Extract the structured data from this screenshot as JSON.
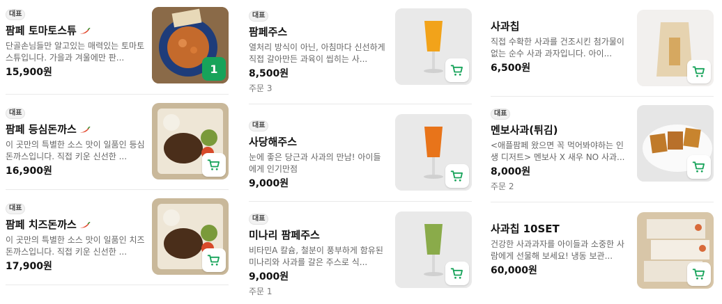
{
  "colors": {
    "accent": "#17a35a",
    "badge_bg": "#f2f2f2",
    "divider": "#e9e9e9"
  },
  "columns": [
    {
      "items": [
        {
          "badge": "대표",
          "name": "팜페 토마토스튜",
          "spicy": true,
          "desc": "단골손님들만 알고있는 매력있는 토마토스튜입니다. 가을과 겨울에만 판...",
          "price": "15,900원",
          "orders": "",
          "cart_qty": "1",
          "image": "tomato-stew"
        },
        {
          "badge": "대표",
          "name": "팜페 등심돈까스",
          "spicy": true,
          "desc": "이 곳만의 특별한 소스 맛이 일품인 등심돈까스입니다. 직접 키운 신선한 ...",
          "price": "16,900원",
          "orders": "",
          "cart_qty": "",
          "image": "pork-cutlet"
        },
        {
          "badge": "대표",
          "name": "팜페 치즈돈까스",
          "spicy": true,
          "desc": "이 곳만의 특별한 소스 맛이 일품인 치즈돈까스입니다. 직접 키운 신선한 ...",
          "price": "17,900원",
          "orders": "",
          "cart_qty": "",
          "image": "cheese-cutlet"
        }
      ]
    },
    {
      "items": [
        {
          "badge": "대표",
          "name": "팜페주스",
          "spicy": false,
          "desc": "열처리 방식이 아닌, 아침마다 신선하게 직접 갈아만든 과육이 씹히는 사...",
          "price": "8,500원",
          "orders": "주문 3",
          "cart_qty": "",
          "image": "orange-juice"
        },
        {
          "badge": "대표",
          "name": "사당해주스",
          "spicy": false,
          "desc": "눈에 좋은 당근과 사과의 만남! 아이들에게 인기만점",
          "price": "9,000원",
          "orders": "",
          "cart_qty": "",
          "image": "carrot-juice"
        },
        {
          "badge": "대표",
          "name": "미나리 팜페주스",
          "spicy": false,
          "desc": "비타민A 칼슘, 철분이 풍부하게 함유된 미나리와 사과를 갈은 주스로 식...",
          "price": "9,000원",
          "orders": "주문 1",
          "cart_qty": "",
          "image": "green-juice"
        }
      ]
    },
    {
      "items": [
        {
          "badge": "",
          "name": "사과칩",
          "spicy": false,
          "desc": "직접 수확한 사과를 건조시킨 첨가물이 없는 순수 사과 과자입니다. 아이...",
          "price": "6,500원",
          "orders": "",
          "cart_qty": "",
          "image": "apple-chips"
        },
        {
          "badge": "대표",
          "name": "멘보사과(튀김)",
          "spicy": false,
          "desc": "<애플팜페 왔으면 꼭 먹어봐야하는 인생 디저트> 멘보사 X 새우 NO 사과...",
          "price": "8,000원",
          "orders": "주문 2",
          "cart_qty": "",
          "image": "menbosa"
        },
        {
          "badge": "",
          "name": "사과칩 10SET",
          "spicy": false,
          "desc": "건강한 사과과자를 아이들과 소중한 사람에게 선물해 보세요! 냉동 보관...",
          "price": "60,000원",
          "orders": "",
          "cart_qty": "",
          "image": "apple-chips-set"
        }
      ]
    }
  ]
}
